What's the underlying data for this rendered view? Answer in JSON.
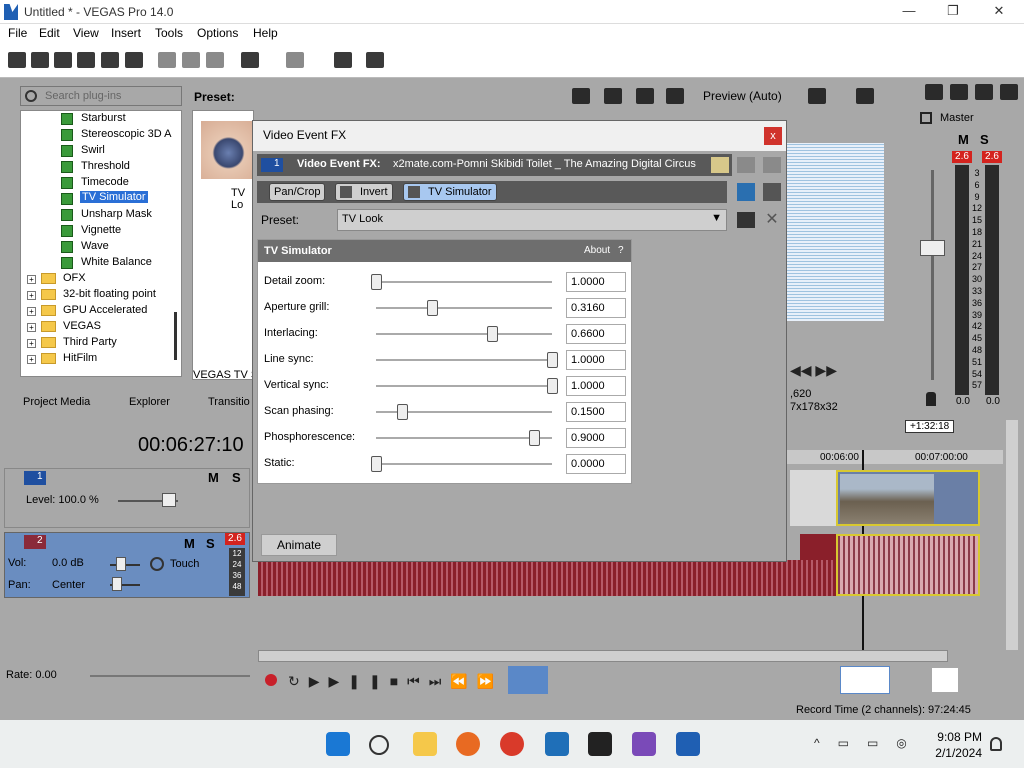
{
  "window": {
    "title": "Untitled * - VEGAS Pro 14.0"
  },
  "menu": [
    "File",
    "Edit",
    "View",
    "Insert",
    "Tools",
    "Options",
    "Help"
  ],
  "plugins": {
    "search_placeholder": "Search plug-ins",
    "preset_label": "Preset:",
    "items": [
      "Starburst",
      "Stereoscopic 3D A",
      "Swirl",
      "Threshold",
      "Timecode",
      "TV Simulator",
      "Unsharp Mask",
      "Vignette",
      "Wave",
      "White Balance"
    ],
    "folders": [
      "OFX",
      "32-bit floating point",
      "GPU Accelerated",
      "VEGAS",
      "Third Party",
      "HitFilm"
    ],
    "preview_text": "TV Lo",
    "footer": "VEGAS TV Si"
  },
  "tabs": [
    "Project Media",
    "Explorer",
    "Transitio"
  ],
  "dialog": {
    "title": "Video Event FX",
    "close": "x",
    "track_num": "1",
    "fx_label": "Video Event FX:",
    "fx_name": "x2mate.com-Pomni Skibidi Toilet _ The Amazing Digital Circus",
    "chain": [
      "Pan/Crop",
      "Invert",
      "TV Simulator"
    ],
    "preset_label": "Preset:",
    "preset_value": "TV Look",
    "panel_title": "TV Simulator",
    "about": "About",
    "help": "?",
    "params": [
      {
        "label": "Detail zoom:",
        "value": "1.0000",
        "pos": 0.0
      },
      {
        "label": "Aperture grill:",
        "value": "0.3160",
        "pos": 0.316
      },
      {
        "label": "Interlacing:",
        "value": "0.6600",
        "pos": 0.66
      },
      {
        "label": "Line sync:",
        "value": "1.0000",
        "pos": 1.0
      },
      {
        "label": "Vertical sync:",
        "value": "1.0000",
        "pos": 1.0
      },
      {
        "label": "Scan phasing:",
        "value": "0.1500",
        "pos": 0.15
      },
      {
        "label": "Phosphorescence:",
        "value": "0.9000",
        "pos": 0.9
      },
      {
        "label": "Static:",
        "value": "0.0000",
        "pos": 0.0
      }
    ],
    "animate": "Animate"
  },
  "preview": {
    "mode": "Preview (Auto)",
    "info1": ",620",
    "info2": "7x178x32"
  },
  "master": {
    "label": "Master",
    "m": "M",
    "s": "S",
    "peak_l": "2.6",
    "peak_r": "2.6",
    "scale": [
      "3",
      "6",
      "9",
      "12",
      "15",
      "18",
      "21",
      "24",
      "27",
      "30",
      "33",
      "36",
      "39",
      "42",
      "45",
      "48",
      "51",
      "54",
      "57"
    ],
    "bottom_l": "0.0",
    "bottom_r": "0.0"
  },
  "timeline": {
    "timecode": "00:06:27:10",
    "marker": "+1:32:18",
    "t1": "00:06:00",
    "t2": "00:07:00:00",
    "track1": {
      "num": "1",
      "level": "Level: 100.0 %",
      "m": "M",
      "s": "S"
    },
    "track2": {
      "num": "2",
      "vol": "Vol:",
      "vol_val": "0.0 dB",
      "pan": "Pan:",
      "pan_val": "Center",
      "touch": "Touch",
      "m": "M",
      "s": "S",
      "peak": "2.6",
      "meter": [
        "12",
        "24",
        "36",
        "48"
      ]
    },
    "rate": "Rate: 0.00",
    "record": "Record Time (2 channels): 97:24:45"
  },
  "taskbar": {
    "time": "9:08 PM",
    "date": "2/1/2024"
  }
}
